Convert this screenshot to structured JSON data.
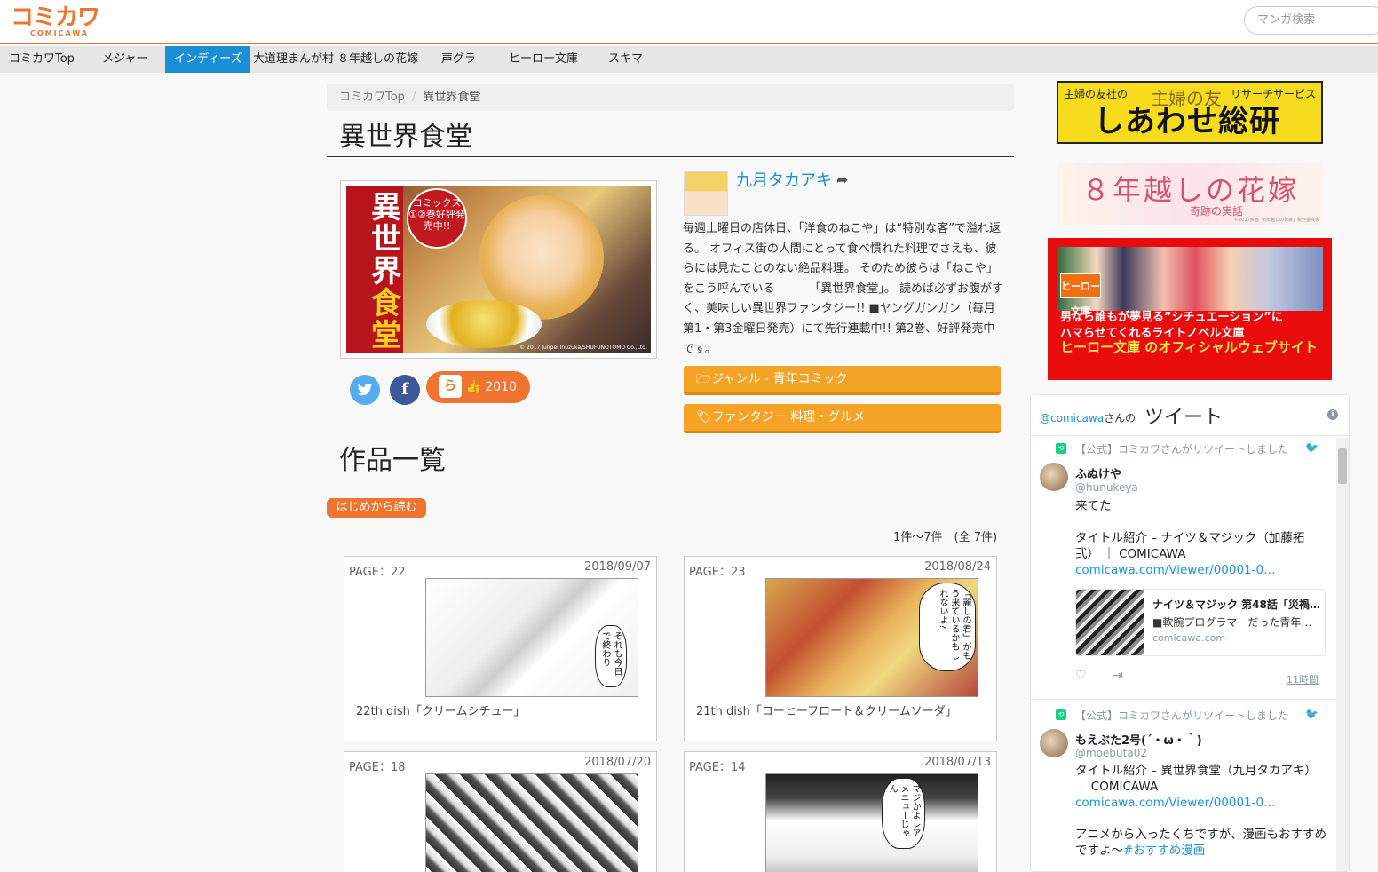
{
  "header": {
    "logo_main": "コミカワ",
    "logo_sub": "COMICAWA",
    "search_placeholder": "マンガ検索"
  },
  "nav": {
    "items": [
      "コミカワTop",
      "メジャー",
      "インディーズ",
      "大道理まんが村",
      "８年越しの花嫁",
      "声グラ",
      "ヒーロー文庫",
      "スキマ"
    ],
    "active_index": 2
  },
  "breadcrumb": {
    "home": "コミカワTop",
    "separator": "/",
    "current": "異世界食堂"
  },
  "work": {
    "title": "異世界食堂",
    "cover": {
      "title_line1": "異世界",
      "title_line2": "食堂",
      "badge": "コミックス①②巻好評発売中!!",
      "copyright": "© 2017 Junpei Inuzuka/SHUFUNOTOMO Co.,Ltd."
    },
    "author": "九月タカアキ",
    "description": "毎週土曜日の店休日、「洋食のねこや」は“特別な客”で溢れ返る。 オフィス街の人間にとって食べ慣れた料理でさえも、彼らには見たことのない絶品料理。 そのため彼らは「ねこや」をこう呼んでいる———「異世界食堂」。 読めば必ずお腹がすく、美味しい異世界ファンタジー!! ■ヤングガンガン（毎月第1・第3金曜日発売）にて先行連載中!! 第2巻、好評発売中です。",
    "likes": "2010",
    "genre_button": "ジャンル - 青年コミック",
    "tags_button": "ファンタジー 料理・グルメ"
  },
  "list": {
    "heading": "作品一覧",
    "read_button": "はじめから読む",
    "count": "1件〜7件　(全 7件)",
    "items": [
      {
        "page": "PAGE：22",
        "date": "2018/09/07",
        "title": "22th dish「クリームシチュー」",
        "bubble": "それも今日で終わり"
      },
      {
        "page": "PAGE：23",
        "date": "2018/08/24",
        "title": "21th dish「コーヒーフロート＆クリームソーダ」",
        "bubble": "「麗しの君」がもう来ているかもしれないよ?"
      },
      {
        "page": "PAGE：18",
        "date": "2018/07/20",
        "title": "",
        "bubble": ""
      },
      {
        "page": "PAGE：14",
        "date": "2018/07/13",
        "title": "",
        "bubble": "マジかよレアメニューじゃん"
      }
    ]
  },
  "ads": {
    "ad1": {
      "left": "主婦の友社の",
      "brand": "主婦の友",
      "right": "リサーチサービス",
      "main": "しあわせ総研"
    },
    "ad2": {
      "main": "８年越しの花嫁",
      "sub": "奇跡の実話",
      "copy": "©2017映画「8年越しの花嫁」製作委員会"
    },
    "ad3": {
      "logo": "ヒーロー文庫",
      "line1": "男なら誰もが夢見る”シチュエーション”に",
      "line2": "ハマらせてくれるライトノベル文庫",
      "line3": "ヒーロー文庫 のオフィシャルウェブサイト"
    }
  },
  "twitter": {
    "handle": "@comicawa",
    "handle_suffix": "さんの",
    "title": "ツイート",
    "tweets": [
      {
        "retweet_note": "【公式】コミカワさんがリツイートしました",
        "name": "ふぬけや",
        "user": "@hunukeya",
        "text1": "来てた",
        "text2": "タイトル紹介 – ナイツ＆マジック（加藤拓弐） ｜ COMICAWA",
        "link": "comicawa.com/Viewer/00001-0…",
        "card_title": "ナイツ＆マジック 第48話「災禍…",
        "card_desc": "■軟腕プログラマーだった青年…",
        "card_domain": "comicawa.com",
        "time": "11時間"
      },
      {
        "retweet_note": "【公式】コミカワさんがリツイートしました",
        "name": "もえぶた2号(´・ω・｀)",
        "user": "@moebuta02",
        "text1": "タイトル紹介 – 異世界食堂（九月タカアキ） ｜ COMICAWA",
        "link": "comicawa.com/Viewer/00001-0…",
        "text2": "アニメから入ったくちですが、漫画もおすすめですよ〜",
        "hashtag": "#おすすめ漫画"
      }
    ]
  },
  "colors": {
    "brand_orange": "#f07430",
    "nav_active": "#1a8fd8",
    "tag_button": "#f5a327",
    "twitter_link": "#1b95e0"
  }
}
